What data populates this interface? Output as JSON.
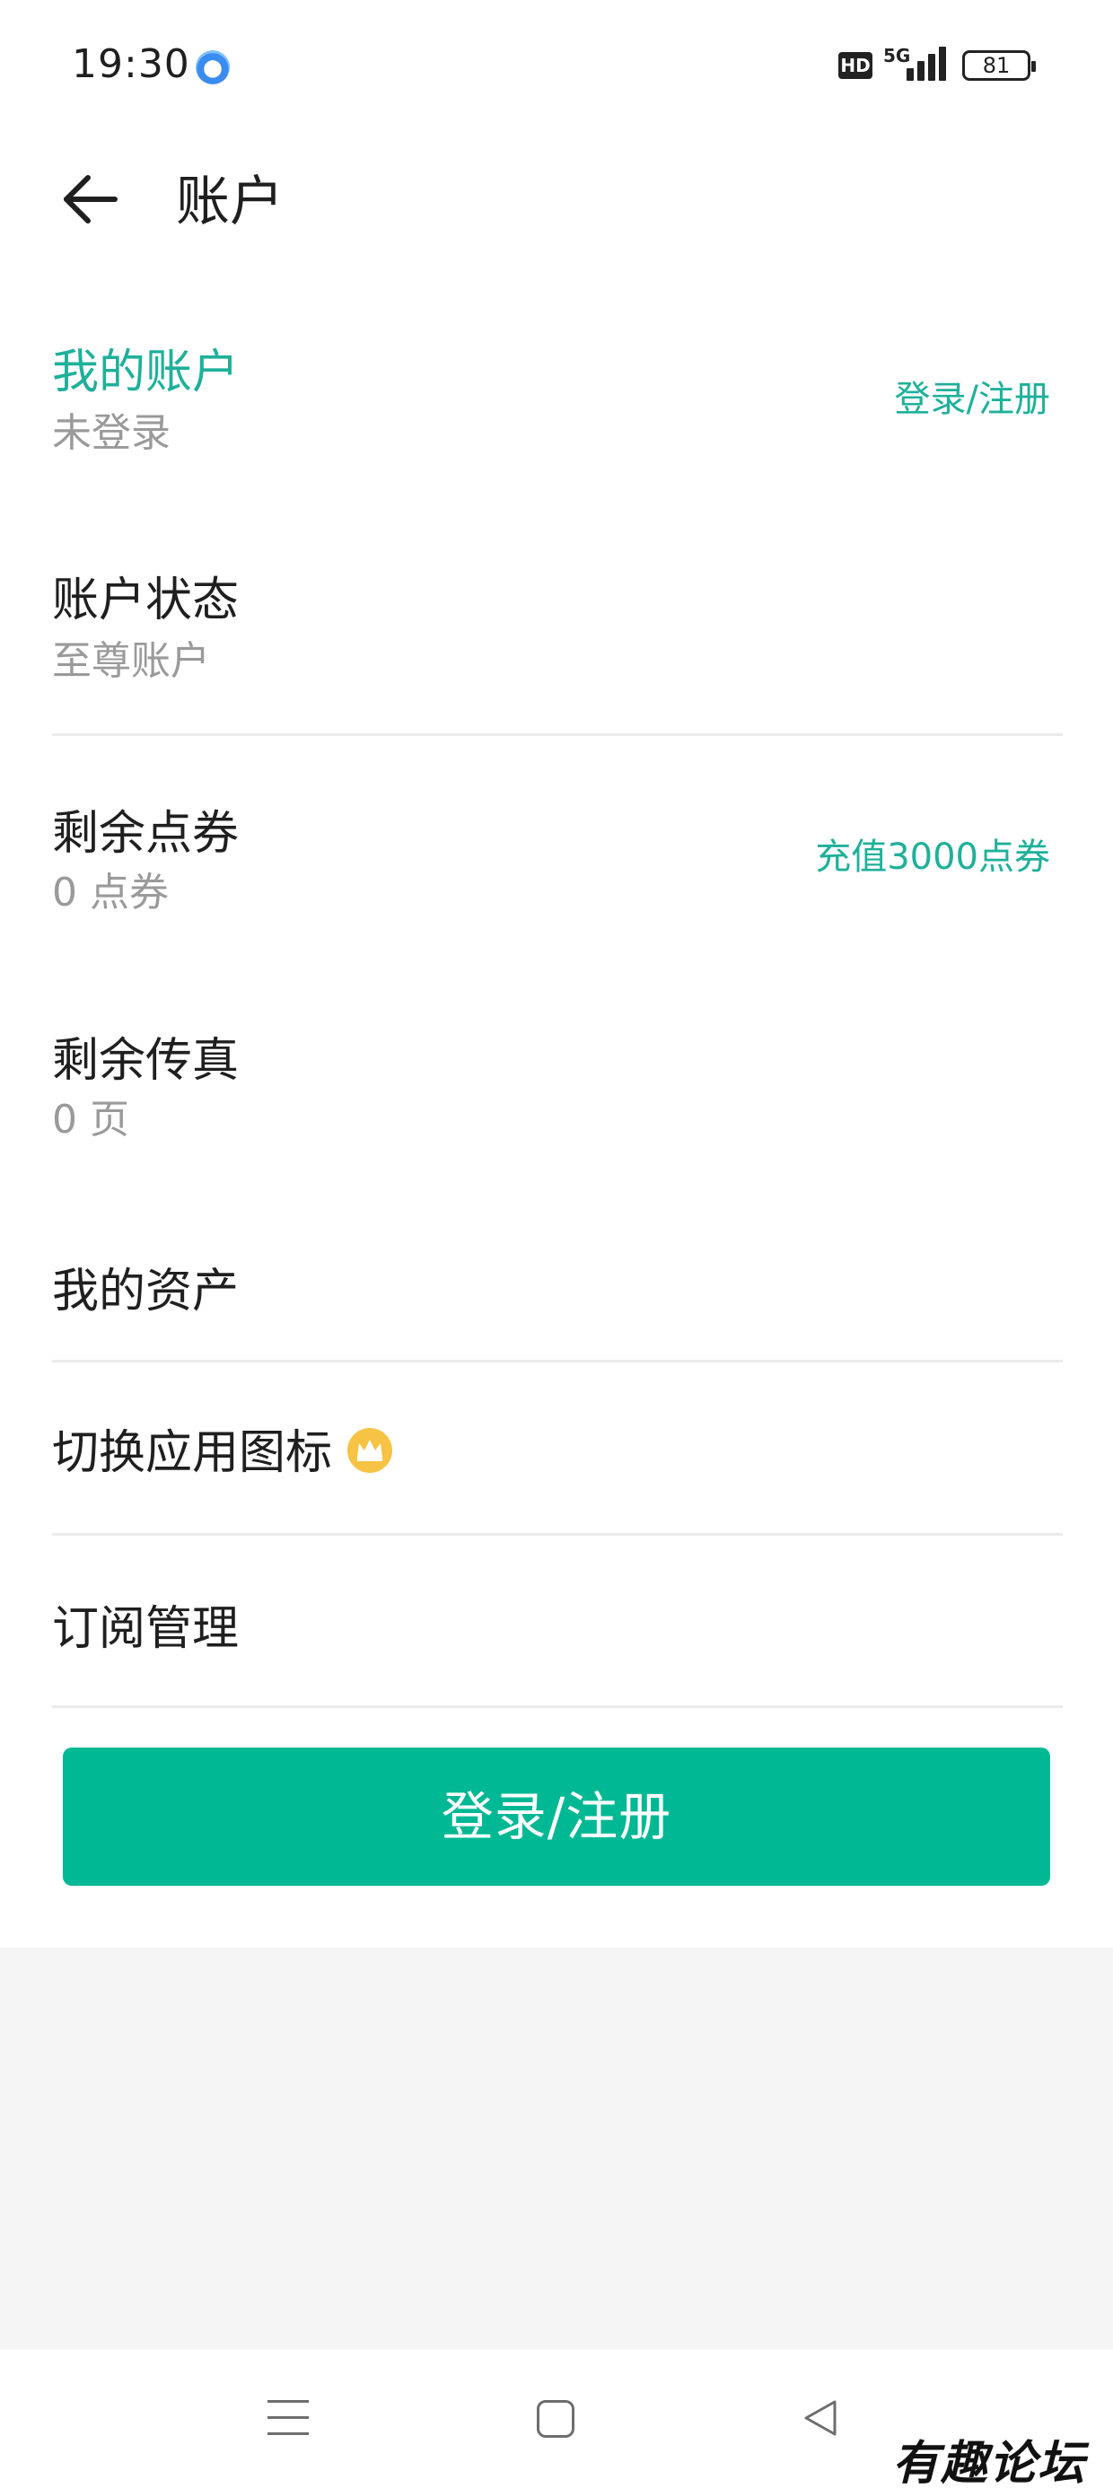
{
  "status_bar": {
    "time": "19:30",
    "network": "5G",
    "hd_label": "HD",
    "battery": "81",
    "icons": [
      "app-notification-icon",
      "hd-icon",
      "signal-icon",
      "battery-icon"
    ]
  },
  "header": {
    "title": "账户",
    "back_icon": "arrow-left-icon"
  },
  "account": {
    "title": "我的账户",
    "subtitle": "未登录",
    "action": "登录/注册"
  },
  "account_status": {
    "title": "账户状态",
    "subtitle": "至尊账户"
  },
  "points": {
    "title": "剩余点券",
    "subtitle": "0 点券",
    "action": "充值3000点券"
  },
  "fax": {
    "title": "剩余传真",
    "subtitle": "0 页"
  },
  "assets": {
    "title": "我的资产"
  },
  "switch_icon": {
    "title": "切换应用图标",
    "icon": "crown-icon"
  },
  "subscription": {
    "title": "订阅管理"
  },
  "login_button": {
    "label": "登录/注册"
  },
  "nav_bar": {
    "icons": [
      "menu-icon",
      "home-icon",
      "back-triangle-icon"
    ]
  },
  "watermark": {
    "text": "有趣论坛"
  },
  "colors": {
    "accent": "#1fb09a",
    "button": "#00b894",
    "subtitle": "#9a9a9a",
    "background_bottom": "#f5f5f5"
  }
}
